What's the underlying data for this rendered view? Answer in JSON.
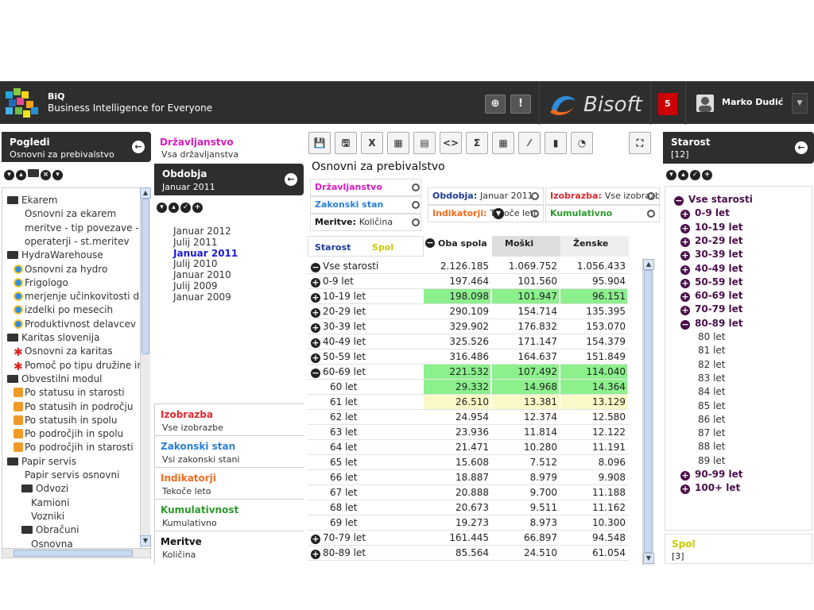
{
  "header": {
    "app_name": "BiQ",
    "tagline": "Business Intelligence for Everyone",
    "help_icon": "help-icon",
    "info_icon": "info-icon",
    "brand": "Bisoft",
    "notifications": "5",
    "user_name": "Marko Dudić"
  },
  "views_panel": {
    "title": "Pogledi",
    "subtitle": "Osnovni za prebivalstvo",
    "tree": [
      {
        "label": "Ekarem",
        "icon": "folder-icon"
      },
      {
        "label": "Osnovni za ekarem",
        "icon": ""
      },
      {
        "label": "meritve - tip povezave - op",
        "icon": ""
      },
      {
        "label": "operaterji - st.meritev",
        "icon": ""
      },
      {
        "label": "HydraWarehouse",
        "icon": "folder-icon"
      },
      {
        "label": "Osnovni za hydro",
        "icon": "hydro-icon"
      },
      {
        "label": "Frigologo",
        "icon": "hydro-icon"
      },
      {
        "label": "merjenje učinkovitosti dela",
        "icon": "hydro-icon"
      },
      {
        "label": "izdelki po mesecih",
        "icon": "hydro-icon"
      },
      {
        "label": "Produktivnost delavcev",
        "icon": "hydro-icon"
      },
      {
        "label": "Karitas slovenija",
        "icon": "folder-icon"
      },
      {
        "label": "Osnovni za karitas",
        "icon": "karitas-icon"
      },
      {
        "label": "Pomoč po tipu družine in s",
        "icon": "karitas-icon"
      },
      {
        "label": "Obvestilni modul",
        "icon": "folder-icon"
      },
      {
        "label": "Po statusu in starosti",
        "icon": "report-icon"
      },
      {
        "label": "Po statusih in področju",
        "icon": "report-icon"
      },
      {
        "label": "Po statusih in spolu",
        "icon": "report-icon"
      },
      {
        "label": "Po področjih in spolu",
        "icon": "report-icon"
      },
      {
        "label": "Po področjih in starosti",
        "icon": "report-icon"
      },
      {
        "label": "Papir servis",
        "icon": "folder-icon"
      },
      {
        "label": "Papir servis osnovni",
        "icon": ""
      },
      {
        "label": "Odvozi",
        "icon": "folder-icon"
      },
      {
        "label": "Kamioni",
        "icon": ""
      },
      {
        "label": "Vozniki",
        "icon": ""
      },
      {
        "label": "Obračuni",
        "icon": "folder-icon"
      },
      {
        "label": "Osnovna",
        "icon": ""
      }
    ]
  },
  "dimensions": {
    "drzavljanstvo": {
      "title": "Državljanstvo",
      "value": "Vsa državljanstva",
      "color": "#d81bbf"
    },
    "obdobja": {
      "title": "Obdobja",
      "value": "Januar 2011"
    },
    "periods": [
      "Januar 2012",
      "Julij 2011",
      "Januar 2011",
      "Julij 2010",
      "Januar 2010",
      "Julij 2009",
      "Januar 2009"
    ],
    "selected_period": "Januar 2011",
    "izobrazba": {
      "title": "Izobrazba",
      "value": "Vse izobrazbe",
      "color": "#e0282e"
    },
    "zakonski_stan": {
      "title": "Zakonski stan",
      "value": "Vsi zakonski stani",
      "color": "#2a7fd4"
    },
    "indikatorji": {
      "title": "Indikatorji",
      "value": "Tekoče leto",
      "color": "#f26b1d"
    },
    "kumulativnost": {
      "title": "Kumulativnost",
      "value": "Kumulativno",
      "color": "#2a9a2a"
    },
    "meritve": {
      "title": "Meritve",
      "value": "Količina",
      "color": "#111111"
    }
  },
  "report": {
    "title": "Osnovni za prebivalstvo",
    "toolbar": [
      "save-icon",
      "save-as-icon",
      "excel-icon",
      "table-layout-icon",
      "pivot-icon",
      "code-icon",
      "sum-icon",
      "grid-icon",
      "line-chart-icon",
      "bar-chart-icon",
      "pie-chart-icon"
    ],
    "toolbar_glyphs": [
      "💾",
      "🖫",
      "X",
      "▦",
      "▤",
      "<>",
      "Σ",
      "▦",
      "⁄",
      "▮",
      "◔"
    ],
    "filters": {
      "drzavljanstvo": "Državljanstvo",
      "zakonski": "Zakonski stan",
      "meritve_lbl": "Meritve:",
      "meritve_val": "Količina",
      "obdobja_lbl": "Obdobja:",
      "obdobja_val": "Januar 2011",
      "izobrazba_lbl": "Izobrazba:",
      "izobrazba_val": "Vse izobrazbe",
      "indikatorji_lbl": "Indikatorji:",
      "indikatorji_val": "Tekoče leto",
      "kumulativno": "Kumulativno"
    },
    "row_header": "Starost",
    "row_header2": "Spol",
    "col_headers": [
      "Oba spola",
      "Moški",
      "Ženske"
    ],
    "rows": [
      {
        "label": "Vse starosti",
        "sign": "−",
        "level": 0,
        "vals": [
          "2.126.185",
          "1.069.752",
          "1.056.433"
        ],
        "hl": ""
      },
      {
        "label": "0-9 let",
        "sign": "+",
        "level": 0,
        "vals": [
          "197.464",
          "101.560",
          "95.904"
        ],
        "hl": ""
      },
      {
        "label": "10-19 let",
        "sign": "+",
        "level": 0,
        "vals": [
          "198.098",
          "101.947",
          "96.151"
        ],
        "hl": "g"
      },
      {
        "label": "20-29 let",
        "sign": "+",
        "level": 0,
        "vals": [
          "290.109",
          "154.714",
          "135.395"
        ],
        "hl": ""
      },
      {
        "label": "30-39 let",
        "sign": "+",
        "level": 0,
        "vals": [
          "329.902",
          "176.832",
          "153.070"
        ],
        "hl": ""
      },
      {
        "label": "40-49 let",
        "sign": "+",
        "level": 0,
        "vals": [
          "325.526",
          "171.147",
          "154.379"
        ],
        "hl": ""
      },
      {
        "label": "50-59 let",
        "sign": "+",
        "level": 0,
        "vals": [
          "316.486",
          "164.637",
          "151.849"
        ],
        "hl": ""
      },
      {
        "label": "60-69 let",
        "sign": "−",
        "level": 0,
        "vals": [
          "221.532",
          "107.492",
          "114.040"
        ],
        "hl": "g"
      },
      {
        "label": "60 let",
        "sign": "",
        "level": 1,
        "vals": [
          "29.332",
          "14.968",
          "14.364"
        ],
        "hl": "g"
      },
      {
        "label": "61 let",
        "sign": "",
        "level": 1,
        "vals": [
          "26.510",
          "13.381",
          "13.129"
        ],
        "hl": "y"
      },
      {
        "label": "62 let",
        "sign": "",
        "level": 1,
        "vals": [
          "24.954",
          "12.374",
          "12.580"
        ],
        "hl": ""
      },
      {
        "label": "63 let",
        "sign": "",
        "level": 1,
        "vals": [
          "23.936",
          "11.814",
          "12.122"
        ],
        "hl": ""
      },
      {
        "label": "64 let",
        "sign": "",
        "level": 1,
        "vals": [
          "21.471",
          "10.280",
          "11.191"
        ],
        "hl": ""
      },
      {
        "label": "65 let",
        "sign": "",
        "level": 1,
        "vals": [
          "15.608",
          "7.512",
          "8.096"
        ],
        "hl": ""
      },
      {
        "label": "66 let",
        "sign": "",
        "level": 1,
        "vals": [
          "18.887",
          "8.979",
          "9.908"
        ],
        "hl": ""
      },
      {
        "label": "67 let",
        "sign": "",
        "level": 1,
        "vals": [
          "20.888",
          "9.700",
          "11.188"
        ],
        "hl": ""
      },
      {
        "label": "68 let",
        "sign": "",
        "level": 1,
        "vals": [
          "20.673",
          "9.511",
          "11.162"
        ],
        "hl": ""
      },
      {
        "label": "69 let",
        "sign": "",
        "level": 1,
        "vals": [
          "19.273",
          "8.973",
          "10.300"
        ],
        "hl": ""
      },
      {
        "label": "70-79 let",
        "sign": "+",
        "level": 0,
        "vals": [
          "161.445",
          "66.897",
          "94.548"
        ],
        "hl": ""
      },
      {
        "label": "80-89 let",
        "sign": "+",
        "level": 0,
        "vals": [
          "85.564",
          "24.510",
          "61.054"
        ],
        "hl": ""
      }
    ]
  },
  "right_panel": {
    "title": "Starost",
    "subtitle": "[12]",
    "items": [
      {
        "label": "Vse starosti",
        "sign": "−",
        "level": 0
      },
      {
        "label": "0-9 let",
        "sign": "+",
        "level": 1
      },
      {
        "label": "10-19 let",
        "sign": "+",
        "level": 1
      },
      {
        "label": "20-29 let",
        "sign": "+",
        "level": 1
      },
      {
        "label": "30-39 let",
        "sign": "+",
        "level": 1
      },
      {
        "label": "40-49 let",
        "sign": "+",
        "level": 1
      },
      {
        "label": "50-59 let",
        "sign": "+",
        "level": 1
      },
      {
        "label": "60-69 let",
        "sign": "+",
        "level": 1
      },
      {
        "label": "70-79 let",
        "sign": "+",
        "level": 1
      },
      {
        "label": "80-89 let",
        "sign": "−",
        "level": 1
      },
      {
        "label": "80 let",
        "sign": "",
        "level": 2
      },
      {
        "label": "81 let",
        "sign": "",
        "level": 2
      },
      {
        "label": "82 let",
        "sign": "",
        "level": 2
      },
      {
        "label": "83 let",
        "sign": "",
        "level": 2
      },
      {
        "label": "84 let",
        "sign": "",
        "level": 2
      },
      {
        "label": "85 let",
        "sign": "",
        "level": 2
      },
      {
        "label": "86 let",
        "sign": "",
        "level": 2
      },
      {
        "label": "87 let",
        "sign": "",
        "level": 2
      },
      {
        "label": "88 let",
        "sign": "",
        "level": 2
      },
      {
        "label": "89 let",
        "sign": "",
        "level": 2
      },
      {
        "label": "90-99 let",
        "sign": "+",
        "level": 1
      },
      {
        "label": "100+ let",
        "sign": "+",
        "level": 1
      }
    ],
    "spol_title": "Spol",
    "spol_sub": "[3]"
  }
}
